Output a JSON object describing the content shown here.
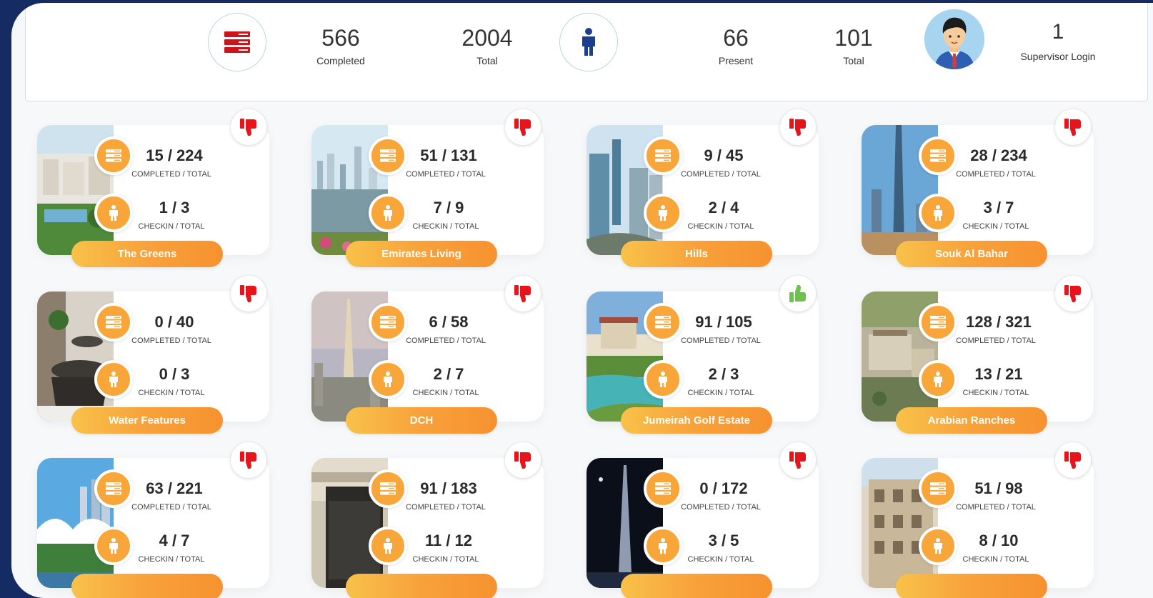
{
  "summary": {
    "tasks": {
      "completed": "566",
      "completed_label": "Completed",
      "total": "2004",
      "total_label": "Total"
    },
    "staff": {
      "present": "66",
      "present_label": "Present",
      "total": "101",
      "total_label": "Total"
    },
    "supervisor": {
      "count": "1",
      "label": "Supervisor Login"
    }
  },
  "labels": {
    "completed_total": "COMPLETED / TOTAL",
    "checkin_total": "CHECKIN / TOTAL"
  },
  "colors": {
    "accent": "#f8a53a",
    "thumb_down": "#e8141c",
    "thumb_up": "#6cc24a",
    "background": "#142c63"
  },
  "cards": [
    {
      "name": "The Greens",
      "completed": "15 / 224",
      "checkin": "1 / 3",
      "status_icon": "thumbs-down-icon"
    },
    {
      "name": "Emirates Living",
      "completed": "51 / 131",
      "checkin": "7 / 9",
      "status_icon": "thumbs-down-icon"
    },
    {
      "name": "Hills",
      "completed": "9 / 45",
      "checkin": "2 / 4",
      "status_icon": "thumbs-down-icon"
    },
    {
      "name": "Souk Al Bahar",
      "completed": "28 / 234",
      "checkin": "3 / 7",
      "status_icon": "thumbs-down-icon"
    },
    {
      "name": "Water Features",
      "completed": "0 / 40",
      "checkin": "0 / 3",
      "status_icon": "thumbs-down-icon"
    },
    {
      "name": "DCH",
      "completed": "6 / 58",
      "checkin": "2 / 7",
      "status_icon": "thumbs-down-icon"
    },
    {
      "name": "Jumeirah Golf Estate",
      "completed": "91 / 105",
      "checkin": "2 / 3",
      "status_icon": "thumbs-up-icon"
    },
    {
      "name": "Arabian Ranches",
      "completed": "128 / 321",
      "checkin": "13 / 21",
      "status_icon": "thumbs-down-icon"
    },
    {
      "name": "",
      "completed": "63 / 221",
      "checkin": "4 / 7",
      "status_icon": "thumbs-down-icon"
    },
    {
      "name": "",
      "completed": "91 / 183",
      "checkin": "11 / 12",
      "status_icon": "thumbs-down-icon"
    },
    {
      "name": "",
      "completed": "0 / 172",
      "checkin": "3 / 5",
      "status_icon": "thumbs-down-icon"
    },
    {
      "name": "",
      "completed": "51 / 98",
      "checkin": "8 / 10",
      "status_icon": "thumbs-down-icon"
    }
  ]
}
